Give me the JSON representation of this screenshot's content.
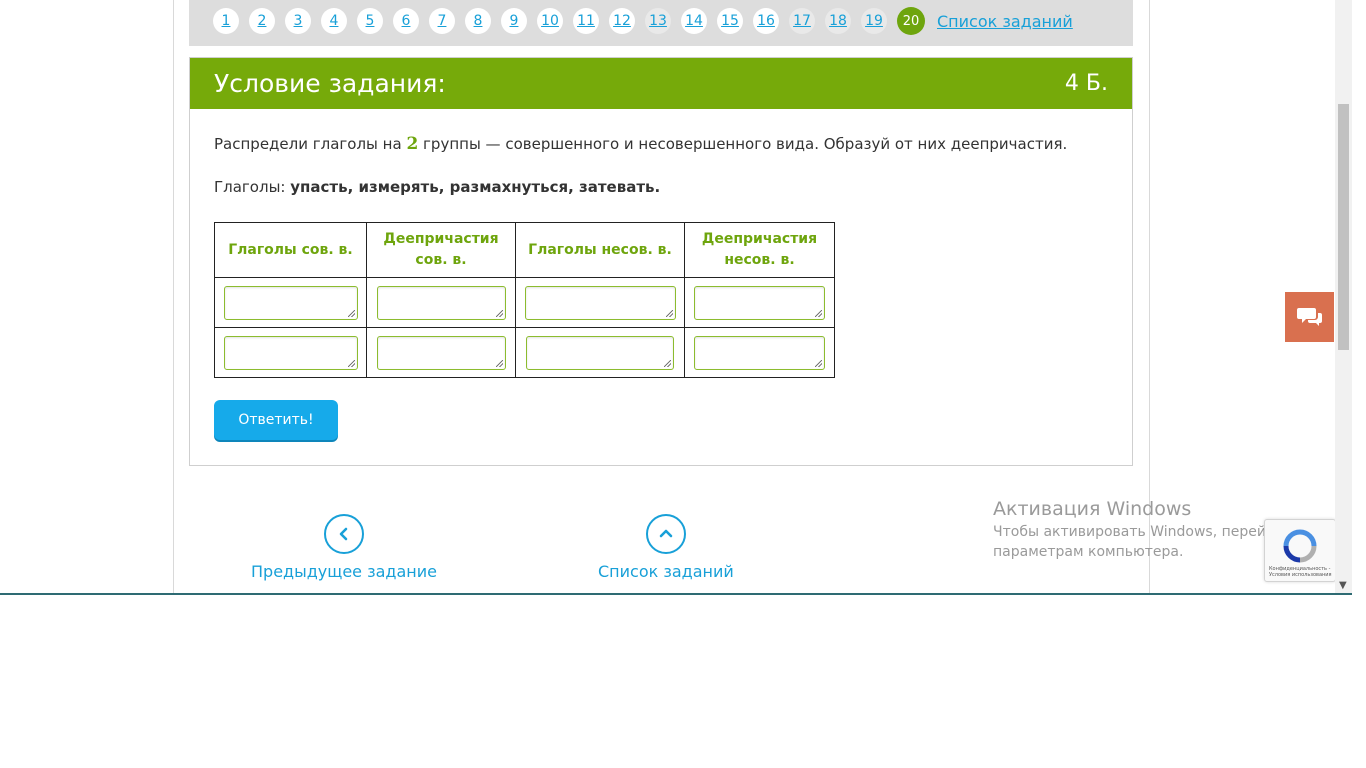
{
  "pager": {
    "pages": [
      {
        "label": "1",
        "state": "normal"
      },
      {
        "label": "2",
        "state": "normal"
      },
      {
        "label": "3",
        "state": "normal"
      },
      {
        "label": "4",
        "state": "normal"
      },
      {
        "label": "5",
        "state": "normal"
      },
      {
        "label": "6",
        "state": "normal"
      },
      {
        "label": "7",
        "state": "normal"
      },
      {
        "label": "8",
        "state": "normal"
      },
      {
        "label": "9",
        "state": "normal"
      },
      {
        "label": "10",
        "state": "normal"
      },
      {
        "label": "11",
        "state": "normal"
      },
      {
        "label": "12",
        "state": "normal"
      },
      {
        "label": "13",
        "state": "done"
      },
      {
        "label": "14",
        "state": "normal"
      },
      {
        "label": "15",
        "state": "normal"
      },
      {
        "label": "16",
        "state": "normal"
      },
      {
        "label": "17",
        "state": "done"
      },
      {
        "label": "18",
        "state": "done"
      },
      {
        "label": "19",
        "state": "done"
      },
      {
        "label": "20",
        "state": "active"
      }
    ],
    "list_link": "Список заданий"
  },
  "task": {
    "title": "Условие задания:",
    "points": "4 Б.",
    "question_prefix": "Распредели глаголы на ",
    "question_number": "2",
    "question_suffix": " группы — совершенного и несовершенного вида. Образуй от них деепричастия.",
    "verbs_label": "Глаголы: ",
    "verbs_list": "упасть, измерять, размахнуться, затевать.",
    "table": {
      "headers": [
        "Глаголы сов. в.",
        "Деепричастия сов. в.",
        "Глаголы несов. в.",
        "Деепричастия несов. в."
      ]
    },
    "answer_button": "Ответить!"
  },
  "navigation": {
    "prev_label": "Предыдущее задание",
    "list_label": "Список заданий"
  },
  "windows_watermark": {
    "title": "Активация Windows",
    "line1": "Чтобы активировать Windows, перейдите к",
    "line2": "параметрам компьютера."
  },
  "recaptcha": {
    "text": "Конфиденциальность - Условия использования"
  },
  "colors": {
    "accent": "#76aa0a",
    "link": "#18a0d8",
    "button": "#16aaea",
    "chat": "#d9704f"
  }
}
